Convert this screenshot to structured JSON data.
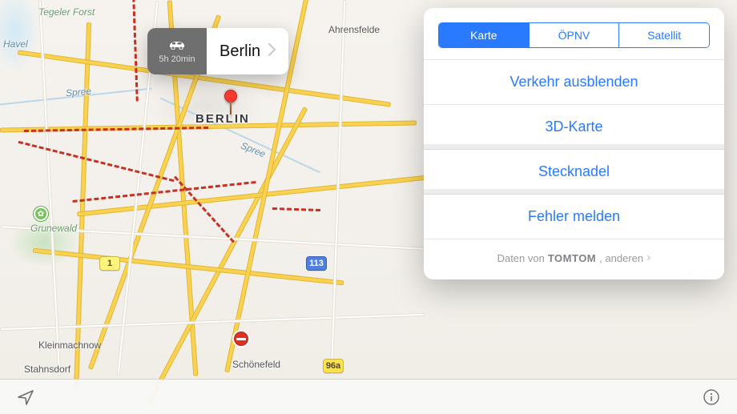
{
  "pin": {
    "title": "Berlin",
    "eta": "5h 20min",
    "mode": "Auto"
  },
  "map": {
    "city_label": "BERLIN",
    "places": {
      "tegeler_forst": "Tegeler Forst",
      "ahrensfelde": "Ahrensfelde",
      "kleinmachnow": "Kleinmachnow",
      "stahnsdorf": "Stahnsdorf",
      "schoenefeld": "Schönefeld",
      "grunewald": "Grunewald"
    },
    "rivers": {
      "spree1": "Spree",
      "spree2": "Spree",
      "havel": "Havel"
    },
    "shields": {
      "b1": "1",
      "a113": "113",
      "b96a": "96a"
    }
  },
  "popover": {
    "segments": {
      "map": "Karte",
      "transit": "ÖPNV",
      "sat": "Satellit"
    },
    "hide_traffic": "Verkehr ausblenden",
    "threedee": "3D-Karte",
    "drop_pin": "Stecknadel",
    "report": "Fehler melden",
    "credits_pre": "Daten von",
    "credits_brand": "TOMTOM",
    "credits_post": ", anderen"
  },
  "colors": {
    "accent": "#297aff",
    "pin": "#ff3b30",
    "traffic": "#c92f22"
  }
}
